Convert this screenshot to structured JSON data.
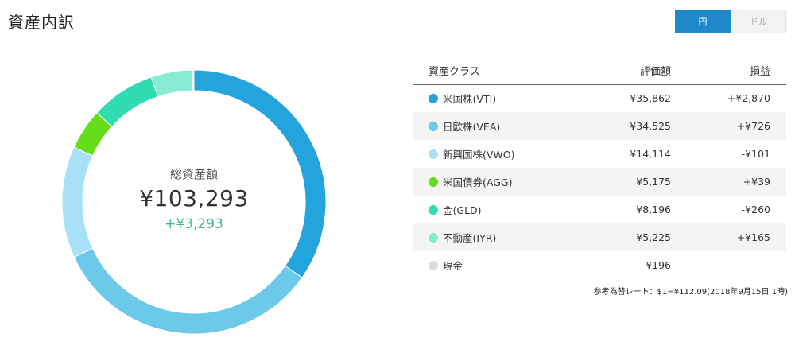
{
  "header": {
    "title": "資産内訳"
  },
  "currency_toggle": [
    {
      "label": "円",
      "active": true
    },
    {
      "label": "ドル",
      "active": false
    }
  ],
  "summary": {
    "label": "総資産額",
    "total": "¥103,293",
    "gain": "+¥3,293"
  },
  "table": {
    "headers": {
      "name": "資産クラス",
      "value": "評価額",
      "gain": "損益"
    },
    "rows": [
      {
        "name": "米国株(VTI)",
        "value": "¥35,862",
        "gain": "+¥2,870",
        "color": "#24a4dc",
        "amount": 35862,
        "sign": "pos"
      },
      {
        "name": "日欧株(VEA)",
        "value": "¥34,525",
        "gain": "+¥726",
        "color": "#6dc9ea",
        "amount": 34525,
        "sign": "pos"
      },
      {
        "name": "新興国株(VWO)",
        "value": "¥14,114",
        "gain": "-¥101",
        "color": "#a8e0f8",
        "amount": 14114,
        "sign": "neg"
      },
      {
        "name": "米国債券(AGG)",
        "value": "¥5,175",
        "gain": "+¥39",
        "color": "#66dd1a",
        "amount": 5175,
        "sign": "pos"
      },
      {
        "name": "金(GLD)",
        "value": "¥8,196",
        "gain": "-¥260",
        "color": "#30dcb0",
        "amount": 8196,
        "sign": "neg"
      },
      {
        "name": "不動産(IYR)",
        "value": "¥5,225",
        "gain": "+¥165",
        "color": "#86ebd0",
        "amount": 5225,
        "sign": "pos"
      },
      {
        "name": "現金",
        "value": "¥196",
        "gain": "-",
        "color": "#dcdcdc",
        "amount": 196,
        "sign": "zero"
      }
    ]
  },
  "rate_note": "参考為替レート：$1=¥112.09(2018年9月15日 1時)"
}
